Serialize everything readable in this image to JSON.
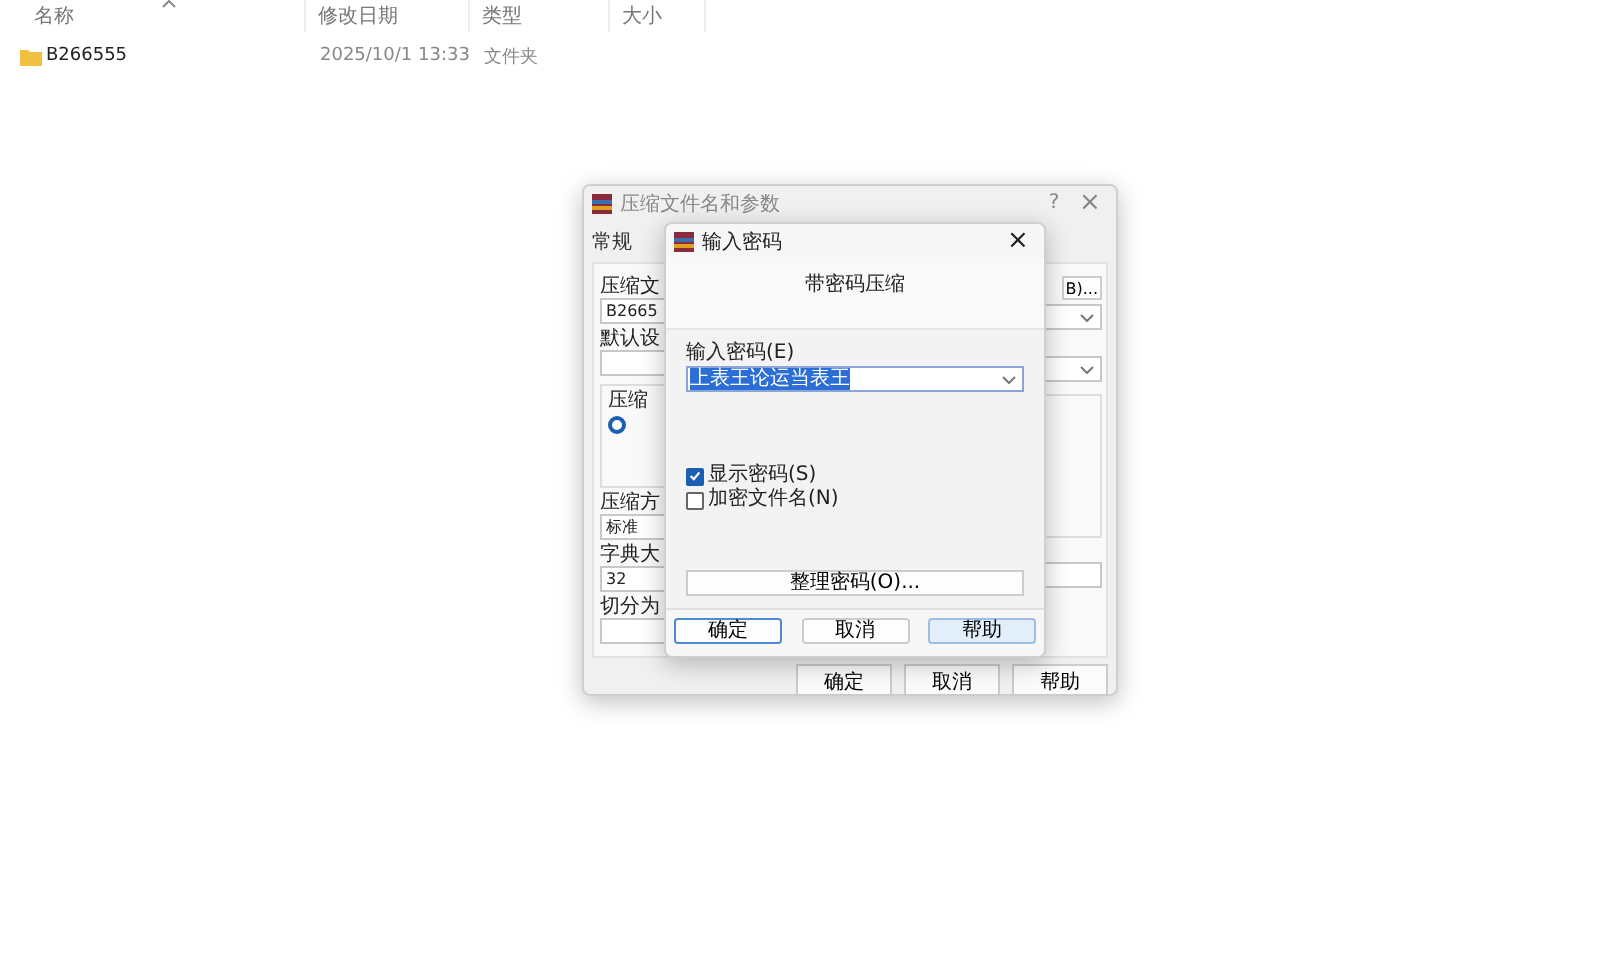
{
  "explorer": {
    "columns": [
      {
        "label": "名称",
        "sorted": true
      },
      {
        "label": "修改日期",
        "sorted": false
      },
      {
        "label": "类型",
        "sorted": false
      },
      {
        "label": "大小",
        "sorted": false
      }
    ],
    "rows": [
      {
        "name": "B266555",
        "modified": "2025/10/1 13:33",
        "type": "文件夹"
      }
    ]
  },
  "back_dialog": {
    "title": "压缩文件名和参数",
    "help": "?",
    "close": "×",
    "tab": "常规",
    "left_labels": [
      "压缩文",
      "默认设",
      "压缩方",
      "字典大",
      "切分为"
    ],
    "archive_name": "B2665",
    "group_label": "压缩",
    "radio_selected": true,
    "method": "标准",
    "dictionary": "32",
    "browse_button": "B)...",
    "buttons": [
      "确定",
      "取消",
      "帮助"
    ]
  },
  "password_dialog": {
    "title": "输入密码",
    "close": "×",
    "heading": "带密码压缩",
    "field_label": "输入密码(E)",
    "password": "上表王论运当表王",
    "password_selected": true,
    "checkboxes": [
      {
        "label": "显示密码(S)",
        "checked": true
      },
      {
        "label": "加密文件名(N)",
        "checked": false
      }
    ],
    "organize_button": "整理密码(O)...",
    "buttons": [
      {
        "label": "确定",
        "kind": "default"
      },
      {
        "label": "取消",
        "kind": "plain"
      },
      {
        "label": "帮助",
        "kind": "hover"
      }
    ]
  }
}
